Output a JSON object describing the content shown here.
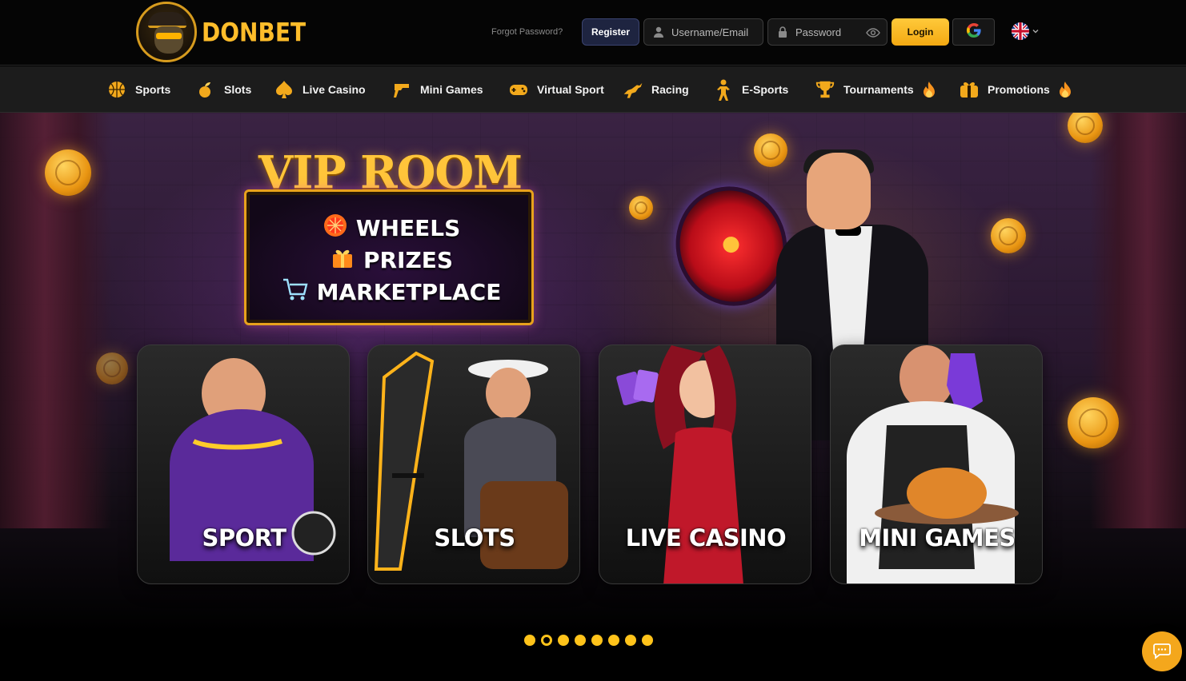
{
  "brand": {
    "name": "DONBET"
  },
  "auth": {
    "forgot_password": "Forgot Password?",
    "register_label": "Register",
    "username_placeholder": "Username/Email",
    "password_placeholder": "Password",
    "login_label": "Login"
  },
  "nav": {
    "items": [
      {
        "label": "Sports",
        "icon": "basketball-icon"
      },
      {
        "label": "Slots",
        "icon": "fruit-icon"
      },
      {
        "label": "Live Casino",
        "icon": "spade-icon"
      },
      {
        "label": "Mini Games",
        "icon": "pistol-icon"
      },
      {
        "label": "Virtual Sport",
        "icon": "gamepad-icon"
      },
      {
        "label": "Racing",
        "icon": "horse-icon"
      },
      {
        "label": "E-Sports",
        "icon": "soldier-icon"
      },
      {
        "label": "Tournaments",
        "icon": "trophy-icon",
        "badge": "flame-icon"
      },
      {
        "label": "Promotions",
        "icon": "gift-icon",
        "badge": "flame-icon"
      }
    ]
  },
  "hero": {
    "title": "VIP ROOM",
    "lines": [
      {
        "text": "WHEELS",
        "icon": "wheel-icon"
      },
      {
        "text": "PRIZES",
        "icon": "gift-icon"
      },
      {
        "text": "MARKETPLACE",
        "icon": "cart-icon"
      }
    ],
    "cards": [
      {
        "label": "SPORT"
      },
      {
        "label": "SLOTS"
      },
      {
        "label": "LIVE CASINO"
      },
      {
        "label": "MINI GAMES"
      }
    ]
  },
  "carousel": {
    "total_slides": 8,
    "active_index": 1
  },
  "colors": {
    "accent": "#ffc31a",
    "register_bg": "#1e2440",
    "nav_bg": "#1c1c1c"
  }
}
